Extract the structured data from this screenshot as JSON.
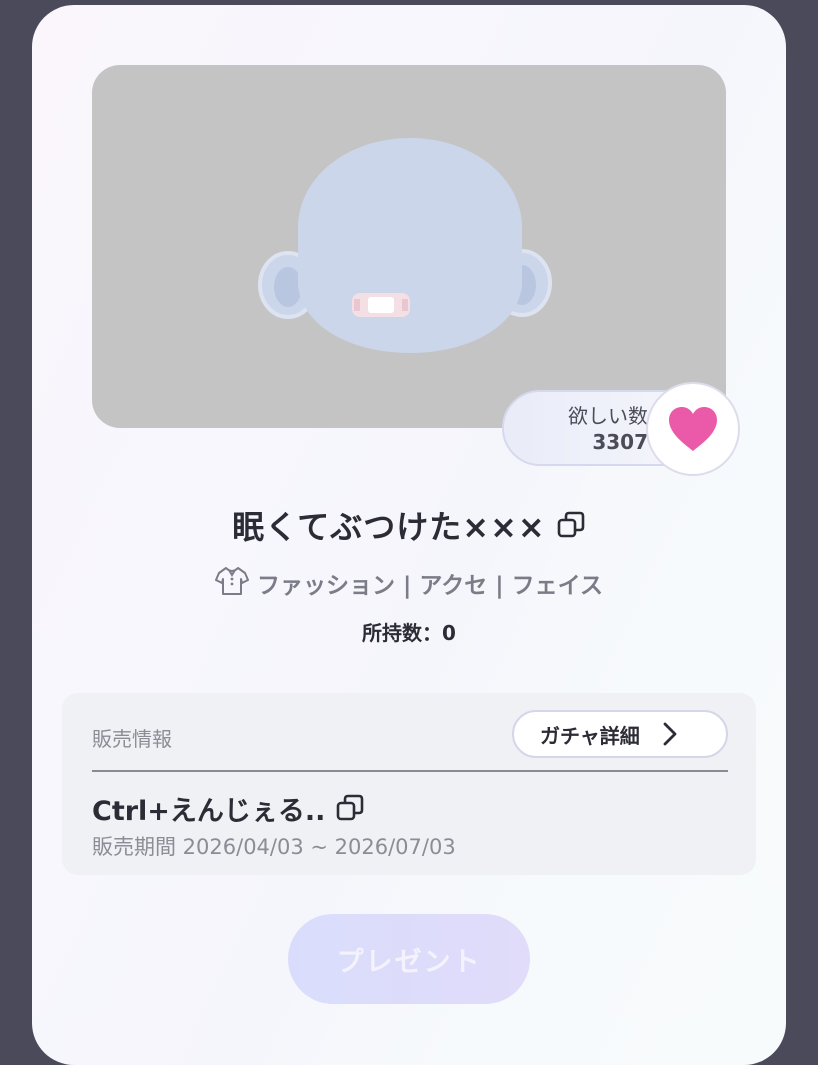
{
  "item": {
    "title": "眠くてぶつけた×××",
    "category": "ファッション | アクセ | フェイス",
    "owned_text": "所持数：0"
  },
  "wishlist": {
    "label": "欲しい数",
    "count": "3307"
  },
  "sales": {
    "section_label": "販売情報",
    "gacha_button_label": "ガチャ詳細",
    "gacha_name": "Ctrl+えんじぇる..",
    "sale_period": "販売期間 2026/04/03 ~ 2026/07/03"
  },
  "present_button_label": "プレゼント",
  "colors": {
    "heart": "#ea5aa8",
    "preview_bg": "#c4c4c4",
    "avatar_head": "#ccd6ea"
  },
  "icons": {
    "heart": "heart-icon",
    "copy": "copy-icon",
    "shirt": "shirt-icon",
    "chevron": "chevron-right-icon"
  }
}
